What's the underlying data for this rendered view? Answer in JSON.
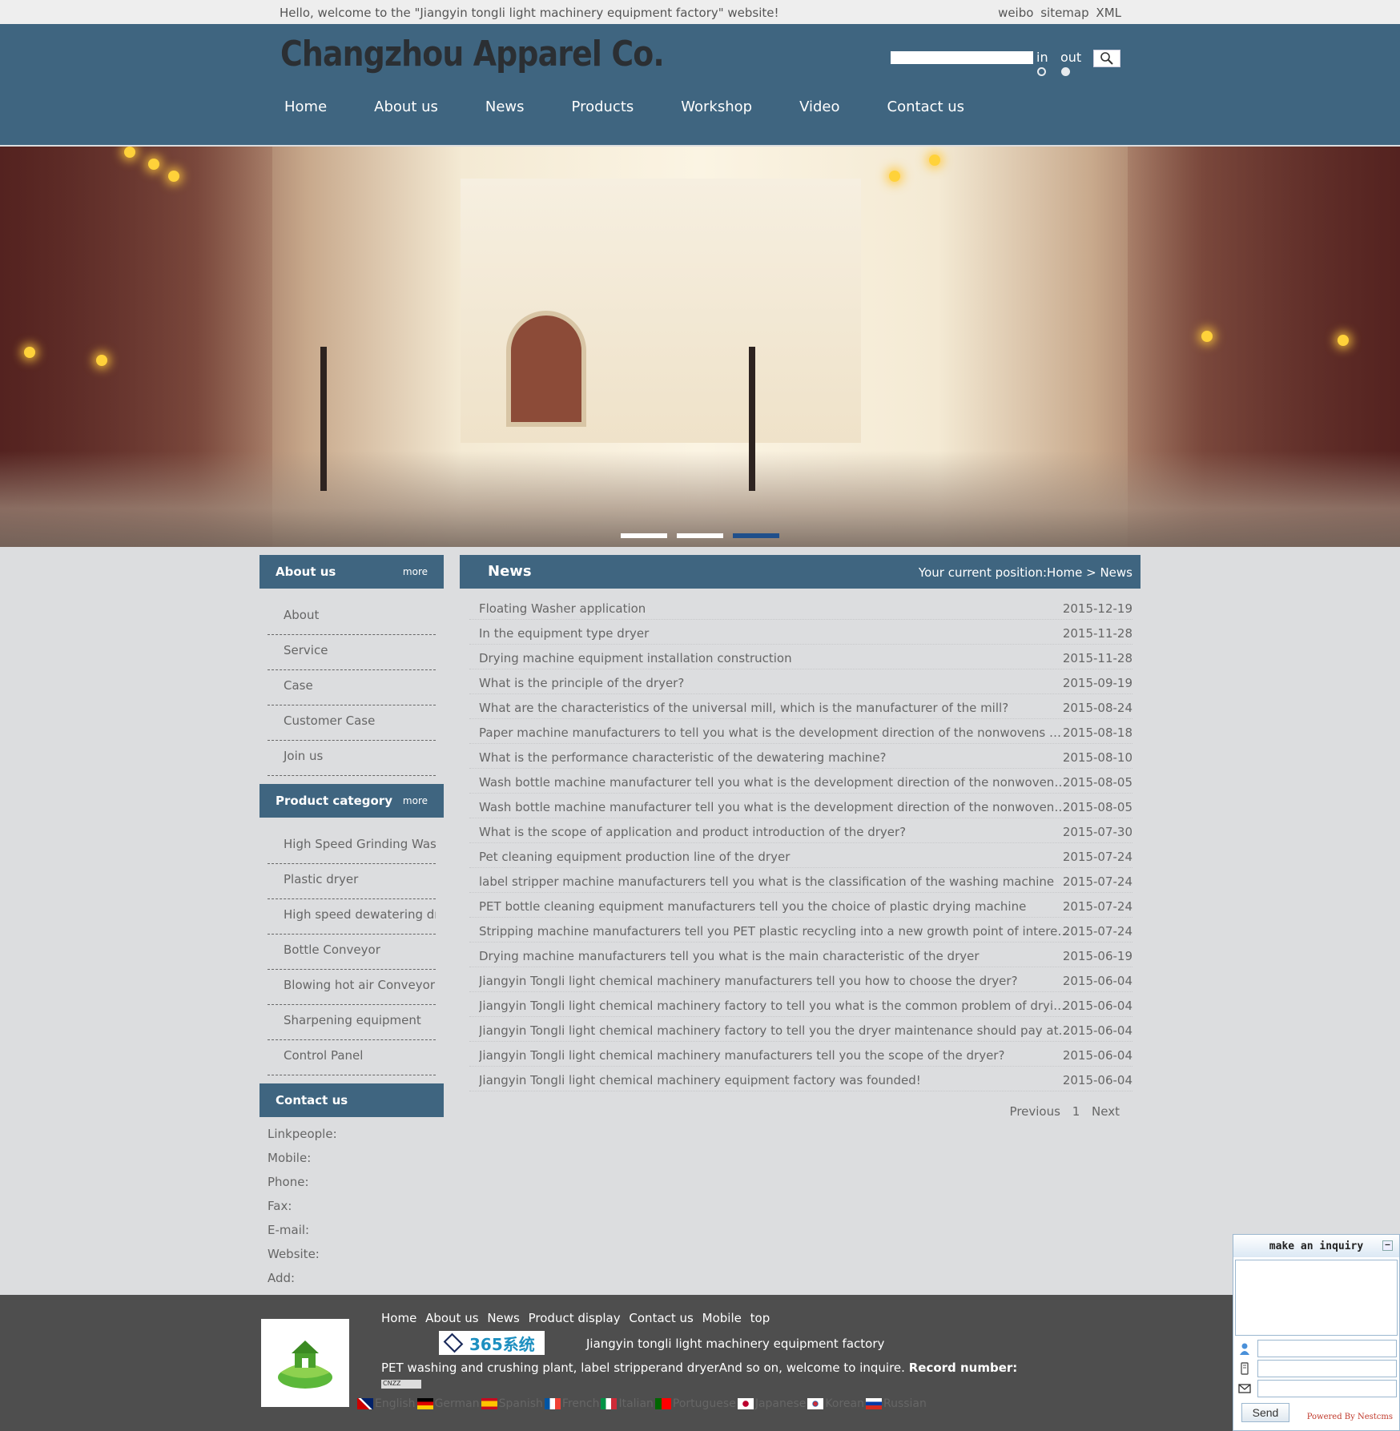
{
  "topbar": {
    "welcome": "Hello, welcome to the \"Jiangyin tongli light machinery equipment factory\" website!",
    "links": [
      "weibo",
      "sitemap",
      "XML"
    ]
  },
  "header": {
    "logo": "Changzhou Apparel Co.",
    "search": {
      "value": "",
      "opt_in": "in",
      "opt_out": "out"
    },
    "nav": [
      "Home",
      "About us",
      "News",
      "Products",
      "Workshop",
      "Video",
      "Contact us"
    ]
  },
  "banner": {
    "slides": 3,
    "active_slide": 3
  },
  "sidebar": {
    "about": {
      "title": "About us",
      "more": "more",
      "items": [
        "About",
        "Service",
        "Case",
        "Customer Case",
        "Join us"
      ]
    },
    "products": {
      "title": "Product category",
      "more": "more",
      "items": [
        "High Speed Grinding Was...",
        "Plastic dryer",
        "High speed dewatering dr...",
        "Bottle Conveyor",
        "Blowing hot air Conveyor",
        "Sharpening equipment",
        "Control Panel"
      ]
    },
    "contact": {
      "title": "Contact us",
      "items": [
        "Linkpeople:",
        "Mobile:",
        "Phone:",
        "Fax:",
        "E-mail:",
        "Website:",
        "Add:"
      ]
    }
  },
  "main": {
    "title": "News",
    "breadcrumb": "Your current position:Home > News",
    "news": [
      {
        "title": "Floating Washer application",
        "date": "2015-12-19"
      },
      {
        "title": "In the equipment type dryer",
        "date": "2015-11-28"
      },
      {
        "title": "Drying machine equipment installation construction",
        "date": "2015-11-28"
      },
      {
        "title": "What is the principle of the dryer?",
        "date": "2015-09-19"
      },
      {
        "title": "What are the characteristics of the universal mill, which is the manufacturer of the mill?",
        "date": "2015-08-24"
      },
      {
        "title": "Paper machine manufacturers to tell you what is the development direction of the nonwovens machinery?",
        "date": "2015-08-18"
      },
      {
        "title": "What is the performance characteristic of the dewatering machine?",
        "date": "2015-08-10"
      },
      {
        "title": "Wash bottle machine manufacturer tell you what is the development direction of the nonwovens machinery?",
        "date": "2015-08-05"
      },
      {
        "title": "Wash bottle machine manufacturer tell you what is the development direction of the nonwovens machinery?",
        "date": "2015-08-05"
      },
      {
        "title": "What is the scope of application and product introduction of the dryer?",
        "date": "2015-07-30"
      },
      {
        "title": "Pet cleaning equipment production line of the dryer",
        "date": "2015-07-24"
      },
      {
        "title": "label stripper machine manufacturers tell you what is the classification of the washing machine",
        "date": "2015-07-24"
      },
      {
        "title": "PET bottle cleaning equipment manufacturers tell you the choice of plastic drying machine",
        "date": "2015-07-24"
      },
      {
        "title": "Stripping machine manufacturers tell you PET plastic recycling into a new growth point of interest is what",
        "date": "2015-07-24"
      },
      {
        "title": "Drying machine manufacturers tell you what is the main characteristic of the dryer",
        "date": "2015-06-19"
      },
      {
        "title": "Jiangyin Tongli light chemical machinery manufacturers tell you how to choose the dryer?",
        "date": "2015-06-04"
      },
      {
        "title": "Jiangyin Tongli light chemical machinery factory to tell you what is the common problem of drying machine?",
        "date": "2015-06-04"
      },
      {
        "title": "Jiangyin Tongli light chemical machinery factory to tell you the dryer maintenance should pay attention to t...",
        "date": "2015-06-04"
      },
      {
        "title": "Jiangyin Tongli light chemical machinery manufacturers tell you the scope of the dryer?",
        "date": "2015-06-04"
      },
      {
        "title": "Jiangyin Tongli light chemical machinery equipment factory was founded!",
        "date": "2015-06-04"
      }
    ],
    "pager": {
      "prev": "Previous",
      "page": "1",
      "next": "Next"
    }
  },
  "footer": {
    "nav": [
      "Home",
      "About us",
      "News",
      "Product display",
      "Contact us",
      "Mobile",
      "top"
    ],
    "badge": "365系统",
    "company": "Jiangyin tongli light machinery equipment factory",
    "desc": "PET washing and crushing plant, label stripperand dryerAnd so on, welcome to inquire.",
    "record_label": "Record number:",
    "cnzz": "CNZZ",
    "languages": [
      "English",
      "German",
      "Spanish",
      "French",
      "Italian",
      "Portuguese",
      "Japanese",
      "Korean",
      "Russian"
    ]
  },
  "inquiry": {
    "title": "make an inquiry",
    "minimize": "–",
    "send": "Send",
    "powered": "Powered By Nestcms"
  },
  "colors": {
    "header": "#3f6580",
    "background": "#dcdddf",
    "footer": "#4e4e4e",
    "active_dot": "#1f4f8b"
  }
}
